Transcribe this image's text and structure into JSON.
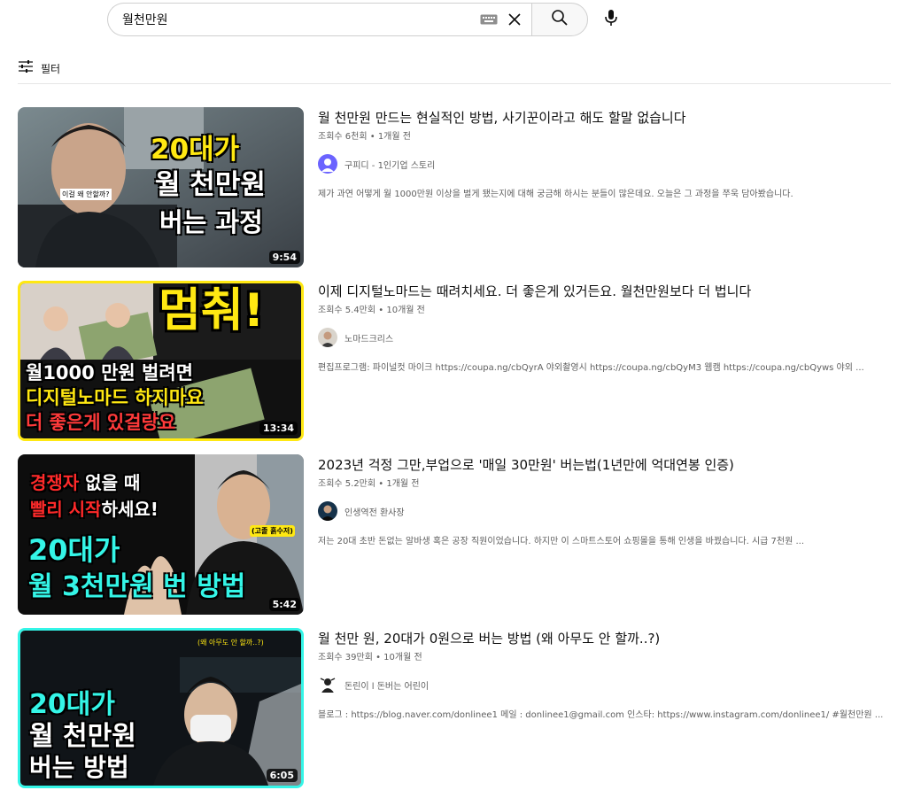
{
  "search": {
    "query": "월천만원",
    "placeholder": "검색"
  },
  "filter": {
    "label": "필터"
  },
  "results": [
    {
      "title": "월 천만원 만드는 현실적인 방법, 사기꾼이라고 해도 할말 없습니다",
      "views": "조회수 6천회",
      "age": "1개월 전",
      "channel": "구피디 - 1인기업 스토리",
      "description": "제가 과연 어떻게 월 1000만원 이상을 벌게 됐는지에 대해 궁금해 하시는 분들이 많은데요. 오늘은 그 과정을 쭈욱 담아봤습니다.",
      "duration": "9:54",
      "thumb_lines": [
        "20대가",
        "월 천만원",
        "버는 과정"
      ],
      "thumb_note": "이걸 왜 안할까?"
    },
    {
      "title": "이제 디지털노마드는 때려치세요. 더 좋은게 있거든요. 월천만원보다 더 법니다",
      "views": "조회수 5.4만회",
      "age": "10개월 전",
      "channel": "노마드크리스",
      "description": "편집프로그램: 파이널컷 마이크 https://coupa.ng/cbQyrA 야외촬영시 https://coupa.ng/cbQyM3 웹캠 https://coupa.ng/cbQyws 야외 ...",
      "duration": "13:34",
      "thumb_big": "멈춰!",
      "thumb_lines": [
        "월1000 만원 벌려면",
        "디지털노마드 하지마요",
        "더 좋은게 있걸랑요"
      ]
    },
    {
      "title": "2023년 걱정 그만,부업으로 '매일 30만원' 버는법(1년만에 억대연봉 인증)",
      "views": "조회수 5.2만회",
      "age": "1개월 전",
      "channel": "인생역전 환사장",
      "description": "저는 20대 초반 돈없는 알바생 혹은 공장 직원이었습니다. 하지만 이 스마트스토어 쇼핑몰을 통해 인생을 바꿨습니다. 시급 7천원 ...",
      "duration": "5:42",
      "thumb_line1a": "경쟁자",
      "thumb_line1b": " 없을 때",
      "thumb_line2a": "빨리 시작",
      "thumb_line2b": "하세요!",
      "thumb_lines": [
        "20대가",
        "월 3천만원 번 방법"
      ],
      "thumb_note": "(고졸 흙수저)"
    },
    {
      "title": "월 천만 원, 20대가 0원으로 버는 방법 (왜 아무도 안 할까..?)",
      "views": "조회수 39만회",
      "age": "10개월 전",
      "channel": "돈린이 l 돈버는 어린이",
      "description": "블로그 : https://blog.naver.com/donlinee1 메일 : donlinee1@gmail.com 인스타: https://www.instagram.com/donlinee1/ #월천만원 ...",
      "duration": "6:05",
      "thumb_lines": [
        "20대가",
        "월 천만원",
        "버는 방법"
      ],
      "thumb_note": "(왜 아무도 안 할까..?)"
    }
  ],
  "colors": {
    "accent_yellow": "#ffe812",
    "accent_cyan": "#34f5e7",
    "accent_red": "#ff2a2a"
  }
}
